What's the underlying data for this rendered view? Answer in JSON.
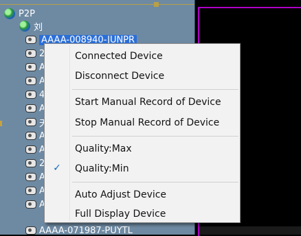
{
  "tree": {
    "root_label": "P2P",
    "group_label": "刘",
    "selected_device": "AAAA-008940-JUNPR",
    "bottom_device": "AAAA-071987-PUYTL",
    "partial_labels": [
      "2",
      "A",
      "A",
      "4",
      "A",
      "天",
      "A",
      "A",
      "2",
      "A",
      "A",
      "A"
    ]
  },
  "context_menu": {
    "items": [
      {
        "label": "Connected Device",
        "checked": false
      },
      {
        "label": "Disconnect Device",
        "checked": false
      },
      {
        "label": "Start Manual Record of Device",
        "checked": false
      },
      {
        "label": "Stop Manual Record of Device",
        "checked": false
      },
      {
        "label": "Quality:Max",
        "checked": false
      },
      {
        "label": "Quality:Min",
        "checked": true
      },
      {
        "label": "Auto Adjust Device",
        "checked": false
      },
      {
        "label": "Full Display Device",
        "checked": false
      }
    ],
    "check_glyph": "✓"
  },
  "colors": {
    "tree_bg": "#6e8aa3",
    "menu_bg": "#f2f2f2",
    "selection": "#2b6fd8",
    "pane_outline": "#b000c8",
    "check": "#1565c0"
  }
}
